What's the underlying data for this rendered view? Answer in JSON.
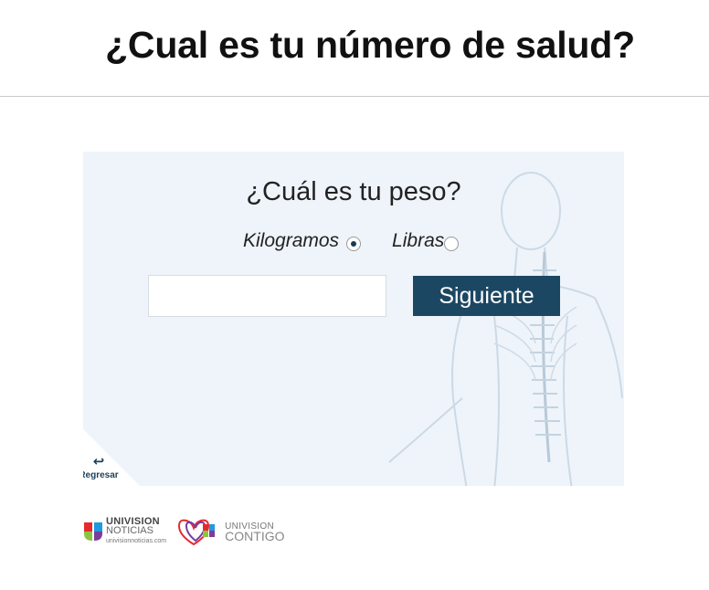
{
  "header": {
    "title": "¿Cual es tu número de salud?"
  },
  "form": {
    "question": "¿Cuál es tu peso?",
    "units": [
      {
        "label": "Kilogramos",
        "selected": true
      },
      {
        "label": "Libras",
        "selected": false
      }
    ],
    "weight_value": "",
    "next_label": "Siguiente",
    "back_label": "Regresar"
  },
  "footer": {
    "noticias_brand": "UNIVISION",
    "noticias_name": "NOTICIAS",
    "noticias_url": "univisionnoticias.com",
    "contigo_brand": "UNIVISION",
    "contigo_name": "CONTIGO"
  },
  "colors": {
    "accent": "#1c4763",
    "card_bg": "#eef4fa"
  }
}
